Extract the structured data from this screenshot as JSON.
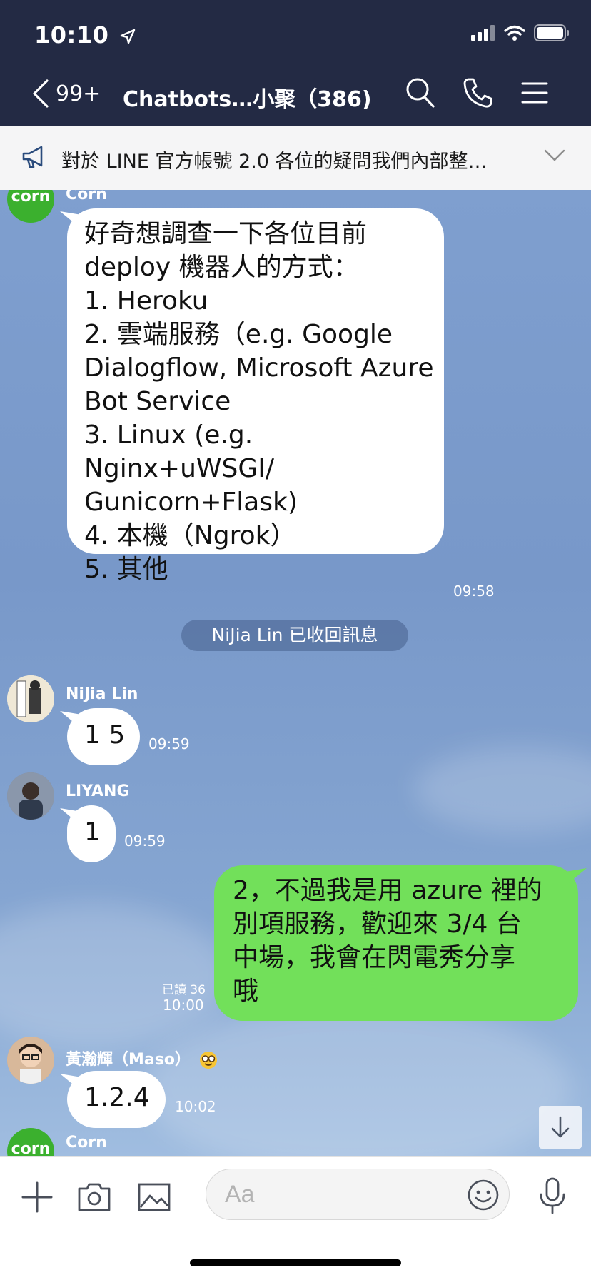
{
  "status_bar": {
    "time": "10:10"
  },
  "nav": {
    "back_count": "99+",
    "title": "Chatbots…小聚（386)"
  },
  "announcement": {
    "text": "對於 LINE 官方帳號 2.0 各位的疑問我們內部整…"
  },
  "messages": {
    "corn1": {
      "sender": "Corn",
      "avatar_text": "corn",
      "lines": [
        "好奇想調查一下各位目前",
        "deploy 機器人的方式：",
        "1. Heroku",
        "2. 雲端服務（e.g. Google",
        "Dialogflow, Microsoft Azure",
        "Bot Service",
        "3. Linux (e.g.",
        "Nginx+uWSGI/",
        "Gunicorn+Flask)",
        "4. 本機（Ngrok）",
        "5. 其他"
      ],
      "time": "09:58"
    },
    "system_notice": "NiJia Lin 已收回訊息",
    "nijia": {
      "sender": "NiJia Lin",
      "text": "1 5",
      "time": "09:59"
    },
    "liyang": {
      "sender": "LIYANG",
      "text": "1",
      "time": "09:59"
    },
    "mine": {
      "lines": [
        "2，不過我是用 azure 裡的",
        "別項服務，歡迎來 3/4 台",
        "中場，我會在閃電秀分享",
        "哦"
      ],
      "read": "已讀 36",
      "time": "10:00"
    },
    "maso": {
      "sender": "黃瀚輝（Maso）",
      "text": "1.2.4",
      "time": "10:02"
    },
    "corn2": {
      "sender": "Corn",
      "avatar_text": "corn"
    }
  },
  "input": {
    "placeholder": "Aa"
  },
  "icons": {
    "location": "location-arrow-icon",
    "signal": "signal-icon",
    "wifi": "wifi-icon",
    "battery": "battery-icon",
    "back": "chevron-left-icon",
    "search": "search-icon",
    "call": "phone-icon",
    "menu": "menu-icon",
    "megaphone": "megaphone-icon",
    "expand": "chevron-down-icon",
    "scroll": "arrow-down-icon",
    "plus": "plus-icon",
    "camera": "camera-icon",
    "image": "image-icon",
    "emoji": "emoji-icon",
    "mic": "microphone-icon"
  },
  "colors": {
    "header_bg": "#232a44",
    "my_bubble": "#72e05a",
    "corn_avatar": "#3bb02e",
    "chat_bg": "#7f9fcf"
  }
}
